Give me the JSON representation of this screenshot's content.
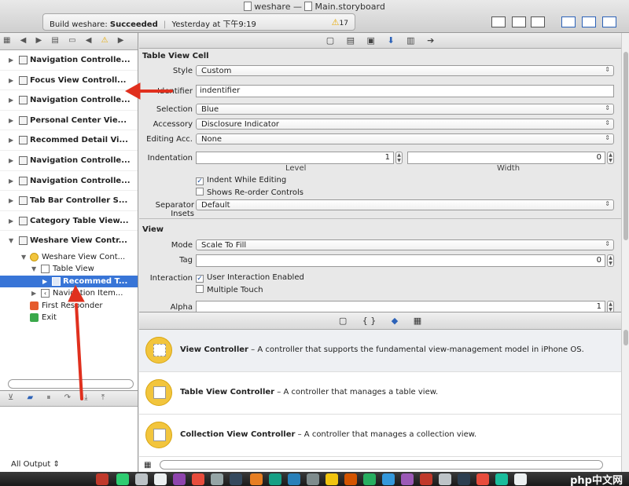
{
  "window": {
    "project": "weshare",
    "separator": "—",
    "file": "Main.storyboard"
  },
  "activity": {
    "prefix": "Build weshare:",
    "status": "Succeeded",
    "time": "Yesterday at 下午9:19",
    "warnings": "17"
  },
  "navigator": {
    "scenes": [
      "Navigation Controlle...",
      "Focus View Controll...",
      "Navigation Controlle...",
      "Personal Center Vie...",
      "Recommed Detail Vi...",
      "Navigation Controlle...",
      "Navigation Controlle...",
      "Tab Bar Controller S...",
      "Category Table View...",
      "Weshare View Contr..."
    ],
    "tree": {
      "controller": "Weshare View Cont...",
      "table_view": "Table View",
      "cell": "Recommed T...",
      "nav_item": "Navigation Item...",
      "first_responder": "First Responder",
      "exit": "Exit"
    }
  },
  "debug": {
    "output_label": "All Output"
  },
  "inspector": {
    "cell_section": "Table View Cell",
    "style_label": "Style",
    "style_value": "Custom",
    "identifier_label": "Identifier",
    "identifier_value": "indentifier",
    "selection_label": "Selection",
    "selection_value": "Blue",
    "accessory_label": "Accessory",
    "accessory_value": "Disclosure Indicator",
    "editing_label": "Editing Acc.",
    "editing_value": "None",
    "indentation_label": "Indentation",
    "level_value": "1",
    "width_value": "0",
    "level_label": "Level",
    "width_label": "Width",
    "indent_while_editing": "Indent While Editing",
    "shows_reorder": "Shows Re-order Controls",
    "separator_label": "Separator Insets",
    "separator_value": "Default",
    "view_section": "View",
    "mode_label": "Mode",
    "mode_value": "Scale To Fill",
    "tag_label": "Tag",
    "tag_value": "0",
    "interaction_label": "Interaction",
    "user_interaction": "User Interaction Enabled",
    "multiple_touch": "Multiple Touch",
    "alpha_label": "Alpha",
    "alpha_value": "1"
  },
  "library": {
    "items": [
      {
        "title": "View Controller",
        "desc": " – A controller that supports the fundamental view-management model in iPhone OS."
      },
      {
        "title": "Table View Controller",
        "desc": " – A controller that manages a table view."
      },
      {
        "title": "Collection View Controller",
        "desc": " – A controller that manages a collection view."
      }
    ]
  },
  "watermark": "php中文网",
  "colors": {
    "selection": "#3875d7",
    "arrow": "#e0301e",
    "library_icon": "#f2c53d"
  }
}
